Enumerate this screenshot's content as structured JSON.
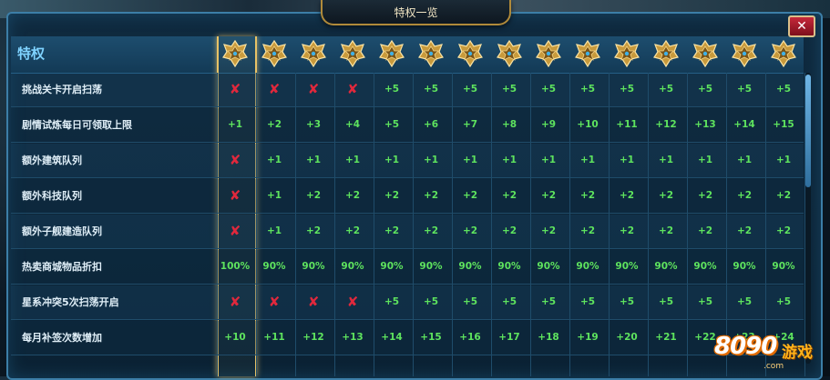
{
  "window": {
    "title": "特权一览",
    "close_symbol": "✕"
  },
  "header": {
    "label": "特权",
    "rank_icons": [
      "vip-rank-0-icon",
      "vip-rank-1-icon",
      "vip-rank-2-icon",
      "vip-rank-3-icon",
      "vip-rank-4-icon",
      "vip-rank-5-icon",
      "vip-rank-6-icon",
      "vip-rank-7-icon",
      "vip-rank-8-icon",
      "vip-rank-9-icon",
      "vip-rank-10-icon",
      "vip-rank-11-icon",
      "vip-rank-12-icon",
      "vip-rank-13-icon",
      "vip-rank-14-icon"
    ]
  },
  "rows": [
    {
      "label": "挑战关卡开启扫荡",
      "values": [
        "✘",
        "✘",
        "✘",
        "✘",
        "+5",
        "+5",
        "+5",
        "+5",
        "+5",
        "+5",
        "+5",
        "+5",
        "+5",
        "+5",
        "+5"
      ]
    },
    {
      "label": "剧情试炼每日可领取上限",
      "values": [
        "+1",
        "+2",
        "+3",
        "+4",
        "+5",
        "+6",
        "+7",
        "+8",
        "+9",
        "+10",
        "+11",
        "+12",
        "+13",
        "+14",
        "+15"
      ]
    },
    {
      "label": "额外建筑队列",
      "values": [
        "✘",
        "+1",
        "+1",
        "+1",
        "+1",
        "+1",
        "+1",
        "+1",
        "+1",
        "+1",
        "+1",
        "+1",
        "+1",
        "+1",
        "+1"
      ]
    },
    {
      "label": "额外科技队列",
      "values": [
        "✘",
        "+1",
        "+2",
        "+2",
        "+2",
        "+2",
        "+2",
        "+2",
        "+2",
        "+2",
        "+2",
        "+2",
        "+2",
        "+2",
        "+2"
      ]
    },
    {
      "label": "额外子舰建造队列",
      "values": [
        "✘",
        "+1",
        "+2",
        "+2",
        "+2",
        "+2",
        "+2",
        "+2",
        "+2",
        "+2",
        "+2",
        "+2",
        "+2",
        "+2",
        "+2"
      ]
    },
    {
      "label": "热卖商城物品折扣",
      "values": [
        "100%",
        "90%",
        "90%",
        "90%",
        "90%",
        "90%",
        "90%",
        "90%",
        "90%",
        "90%",
        "90%",
        "90%",
        "90%",
        "90%",
        "90%"
      ]
    },
    {
      "label": "星系冲突5次扫荡开启",
      "values": [
        "✘",
        "✘",
        "✘",
        "✘",
        "+5",
        "+5",
        "+5",
        "+5",
        "+5",
        "+5",
        "+5",
        "+5",
        "+5",
        "+5",
        "+5"
      ]
    },
    {
      "label": "每月补签次数增加",
      "values": [
        "+10",
        "+11",
        "+12",
        "+13",
        "+14",
        "+15",
        "+16",
        "+17",
        "+18",
        "+19",
        "+20",
        "+21",
        "+22",
        "+23",
        "+24"
      ]
    }
  ],
  "watermark": {
    "brand": "8090",
    "brand_cn": "游戏",
    "url": ".com"
  },
  "colors": {
    "positive": "#5ee35e",
    "negative": "#e0283c",
    "accent": "#e8c266",
    "panel_border": "#3c7ea7"
  }
}
